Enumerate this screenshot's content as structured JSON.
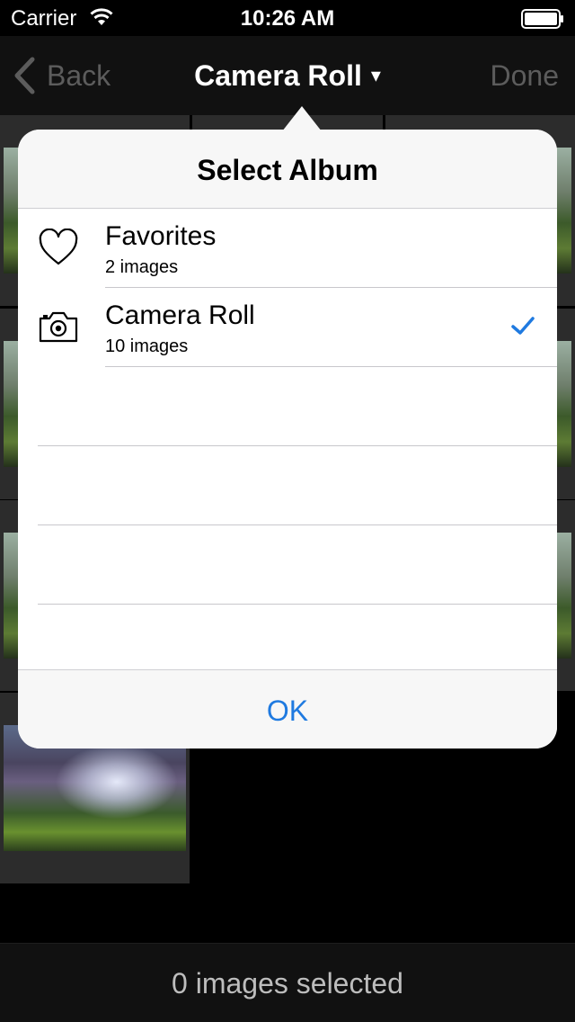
{
  "status_bar": {
    "carrier": "Carrier",
    "time": "10:26 AM"
  },
  "nav": {
    "back_label": "Back",
    "title": "Camera Roll",
    "title_caret": "▾",
    "done_label": "Done"
  },
  "popover": {
    "title": "Select Album",
    "albums": [
      {
        "name": "Favorites",
        "count": "2 images",
        "icon": "heart-icon",
        "selected": false
      },
      {
        "name": "Camera Roll",
        "count": "10 images",
        "icon": "camera-icon",
        "selected": true
      }
    ],
    "ok_label": "OK"
  },
  "footer": {
    "selection_status": "0 images selected"
  },
  "colors": {
    "accent": "#1f7ae0",
    "bar_background": "#111111",
    "disabled_text": "#5c5c5c"
  }
}
